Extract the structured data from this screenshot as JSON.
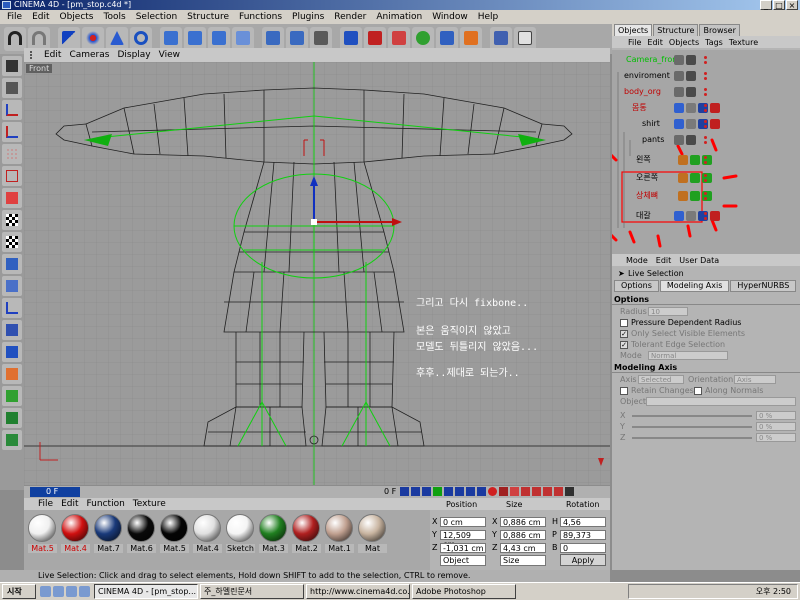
{
  "window": {
    "title": "CINEMA 4D - [pm_stop.c4d *]",
    "buttons": [
      "_",
      "□",
      "×"
    ]
  },
  "menubar": [
    "File",
    "Edit",
    "Objects",
    "Tools",
    "Selection",
    "Structure",
    "Functions",
    "Plugins",
    "Render",
    "Animation",
    "Window",
    "Help"
  ],
  "viewport": {
    "menu": [
      "Edit",
      "Cameras",
      "Display",
      "View"
    ],
    "label": "Front",
    "overlay_text": [
      "그리고 다시 fixbone..",
      "본은 움직이지 않았고",
      "모델도 뒤틀리지 않았음...",
      "후후..제대로 되는가.."
    ]
  },
  "timeline": {
    "current_frame": "0 F",
    "end_frame": "0 F"
  },
  "materials": {
    "menu": [
      "File",
      "Edit",
      "Function",
      "Texture"
    ],
    "items": [
      {
        "label": "Mat.5",
        "color": "#f0f0f0",
        "label_color": "#cc0000"
      },
      {
        "label": "Mat.4",
        "color": "#d01010",
        "label_color": "#cc0000"
      },
      {
        "label": "Mat.7",
        "color": "#1a3a7a",
        "label_color": "#000000"
      },
      {
        "label": "Mat.6",
        "color": "#0a0a0a",
        "label_color": "#000000"
      },
      {
        "label": "Mat.5",
        "color": "#050505",
        "label_color": "#000000"
      },
      {
        "label": "Mat.4",
        "color": "#e0e0e0",
        "label_color": "#000000"
      },
      {
        "label": "Sketch",
        "color": "#f4f4f4",
        "label_color": "#000000"
      },
      {
        "label": "Mat.3",
        "color": "#208020",
        "label_color": "#000000"
      },
      {
        "label": "Mat.2",
        "color": "#b02020",
        "label_color": "#000000"
      },
      {
        "label": "Mat.1",
        "color": "#c0a090",
        "label_color": "#000000"
      },
      {
        "label": "Mat",
        "color": "#c8b4a0",
        "label_color": "#000000"
      }
    ]
  },
  "coordinates": {
    "headers": [
      "Position",
      "Size",
      "Rotation"
    ],
    "rows": [
      {
        "axis": "X",
        "position": "0 cm",
        "size_axis": "X",
        "size": "0,886 cm",
        "rot_axis": "H",
        "rotation": "4,56"
      },
      {
        "axis": "Y",
        "position": "12,509 cm",
        "size_axis": "Y",
        "size": "0,886 cm",
        "rot_axis": "P",
        "rotation": "89,373"
      },
      {
        "axis": "Z",
        "position": "-1,031 cm",
        "size_axis": "Z",
        "size": "4,43 cm",
        "rot_axis": "B",
        "rotation": "0"
      }
    ],
    "mode_select": "Object",
    "size_select": "Size",
    "apply_label": "Apply"
  },
  "statusbar": "Live Selection: Click and drag to select elements, Hold down SHIFT to add to the selection, CTRL to remove.",
  "taskbar": {
    "start": "시작",
    "tasks": [
      "CINEMA 4D - [pm_stop...",
      "주_하멜린문서",
      "http://www.cinema4d.co...",
      "Adobe Photoshop"
    ],
    "clock": "오후 2:50"
  },
  "objects_panel": {
    "tabs": [
      "Objects",
      "Structure",
      "Browser"
    ],
    "menu": [
      "File",
      "Edit",
      "Objects",
      "Tags",
      "Texture"
    ],
    "items": [
      {
        "name": "Camera_front",
        "style": "green"
      },
      {
        "name": "enviroment",
        "style": "normal"
      },
      {
        "name": "body_org",
        "style": "red"
      },
      {
        "name": "몸통",
        "style": "red"
      },
      {
        "name": "shirt",
        "style": "normal"
      },
      {
        "name": "pants",
        "style": "normal"
      },
      {
        "name": "왼쪽",
        "style": "normal"
      },
      {
        "name": "오른쪽",
        "style": "normal"
      },
      {
        "name": "상체뼈",
        "style": "red"
      },
      {
        "name": "대갈",
        "style": "normal"
      }
    ]
  },
  "attributes_panel": {
    "menu": [
      "Mode",
      "Edit",
      "User Data"
    ],
    "title": "Live Selection",
    "tabs": [
      "Options",
      "Modeling Axis",
      "HyperNURBS"
    ],
    "options_header": "Options",
    "radius_label": "Radius",
    "radius_value": "10",
    "pressure_label": "Pressure Dependent Radius",
    "only_visible_label": "Only Select Visible Elements",
    "tolerant_label": "Tolerant Edge Selection",
    "mode_label": "Mode",
    "mode_value": "Normal",
    "axis_header": "Modeling Axis",
    "axis_label": "Axis",
    "axis_value": "Selected",
    "orientation_label": "Orientation",
    "orientation_value": "Axis",
    "retain_label": "Retain Changes",
    "along_normals_label": "Along Normals",
    "object_label": "Object",
    "xyz": [
      {
        "label": "X",
        "value": "0 %"
      },
      {
        "label": "Y",
        "value": "0 %"
      },
      {
        "label": "Z",
        "value": "0 %"
      }
    ]
  }
}
